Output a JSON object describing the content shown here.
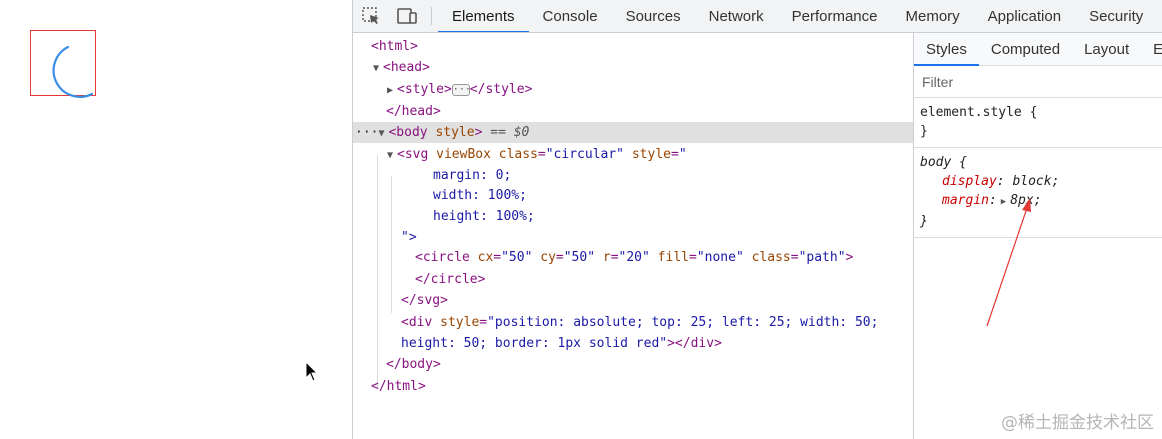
{
  "colors": {
    "accent": "#1a73e8",
    "spinner": "#2196f3",
    "outline": "#e53935",
    "annotation": "#e53935"
  },
  "toolbar": {
    "icons": [
      "inspect-element-icon",
      "device-toolbar-icon"
    ],
    "tabs": [
      "Elements",
      "Console",
      "Sources",
      "Network",
      "Performance",
      "Memory",
      "Application",
      "Security"
    ],
    "active_tab": "Elements"
  },
  "tree": {
    "l1": "<html>",
    "l2": "<head>",
    "l3_open": "<style>",
    "l3_close": "</style>",
    "l4": "</head>",
    "l5_dots": "···",
    "l5_tag": "<body",
    "l5_attr": "style",
    "l5_end": ">",
    "l5_eq": "== $0",
    "l6_tag": "<svg",
    "l6_attr1": "viewBox",
    "l6_attr2": "class",
    "l6_val2": "\"circular\"",
    "l6_attr3": "style",
    "l6_val3": "\"",
    "l7": "margin: 0;",
    "l8": "width: 100%;",
    "l9": "height: 100%;",
    "l10": "\">",
    "l11_tag": "<circle",
    "l11_a1": "cx",
    "l11_v1": "\"50\"",
    "l11_a2": "cy",
    "l11_v2": "\"50\"",
    "l11_a3": "r",
    "l11_v3": "\"20\"",
    "l11_a4": "fill",
    "l11_v4": "\"none\"",
    "l11_a5": "class",
    "l11_v5": "\"path\"",
    "l11_end": ">",
    "l12": "</circle>",
    "l13": "</svg>",
    "l14_tag": "<div",
    "l14_attr": "style",
    "l14_val": "\"position: absolute; top: 25; left: 25; width: 50;",
    "l15_val": "height: 50; border: 1px solid red\"",
    "l15_end": "></div>",
    "l16": "</body>",
    "l17": "</html>"
  },
  "styles_pane": {
    "tabs": [
      "Styles",
      "Computed",
      "Layout",
      "Ev"
    ],
    "active_tab": "Styles",
    "filter_placeholder": "Filter",
    "rule1_selector": "element.style {",
    "rule1_close": "}",
    "rule2_selector": "body {",
    "rule2_prop1_name": "display",
    "rule2_prop1_value": "block;",
    "rule2_prop2_name": "margin",
    "rule2_prop2_value": "8px;",
    "rule2_close": "}"
  },
  "watermark": "@稀土掘金技术社区"
}
